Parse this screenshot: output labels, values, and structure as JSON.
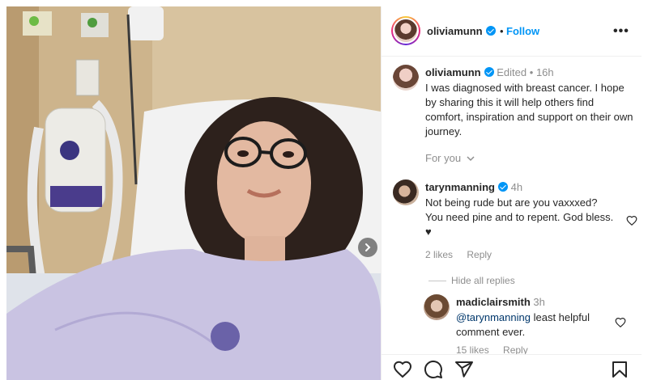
{
  "post": {
    "username": "oliviamunn",
    "separator": "•",
    "follow_label": "Follow",
    "more_label": "•••"
  },
  "caption": {
    "username": "oliviamunn",
    "edited": "Edited",
    "dot": "•",
    "time": "16h",
    "text": "I was diagnosed with breast cancer. I hope by sharing this it will help others find comfort, inspiration and support on their own journey.",
    "translation_label": "For you"
  },
  "comments": [
    {
      "username": "tarynmanning",
      "time": "4h",
      "text": "Not being rude but are you vaxxxed? You need pine and to repent. God bless. ♥",
      "likes": "2 likes",
      "reply_label": "Reply",
      "hide_replies": "Hide all replies"
    }
  ],
  "replies": [
    {
      "username": "madiclairsmith",
      "time": "3h",
      "mention": "@tarynmanning",
      "text": "least helpful comment ever.",
      "likes": "15 likes",
      "reply_label": "Reply"
    }
  ],
  "icons": {
    "like": "heart-icon",
    "comment": "comment-icon",
    "share": "share-icon",
    "save": "bookmark-icon",
    "next": "chevron-right-icon"
  },
  "colors": {
    "link": "#0095f6",
    "verified": "#0095f6",
    "muted": "#8e8e8e",
    "mention": "#00376b"
  }
}
